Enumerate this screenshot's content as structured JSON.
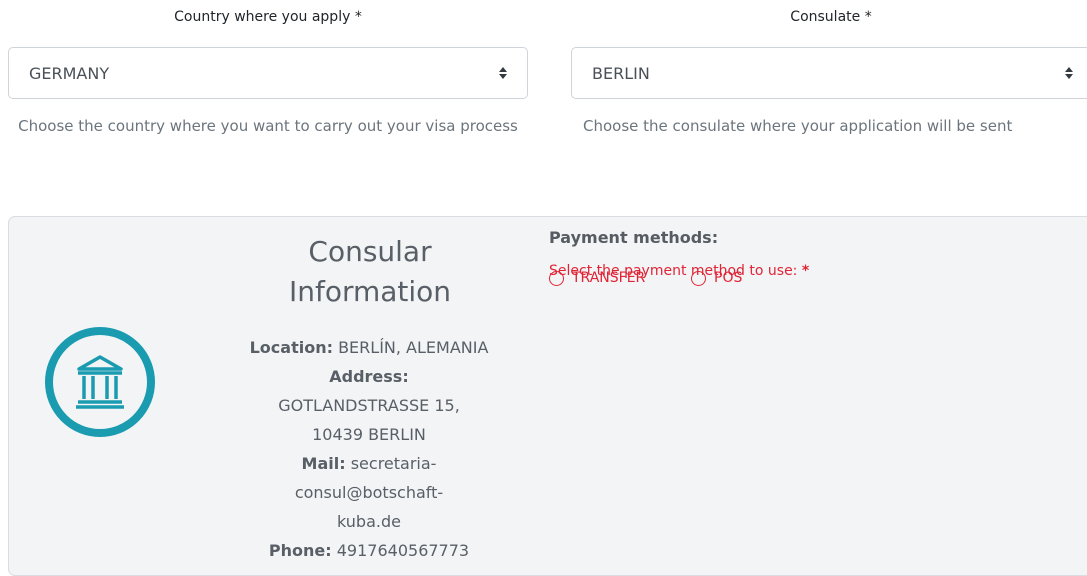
{
  "country": {
    "label": "Country where you apply *",
    "selected": "GERMANY",
    "help": "Choose the country where you want to carry out your visa process"
  },
  "consulate": {
    "label": "Consulate *",
    "selected": "BERLIN",
    "help": "Choose the consulate where your application will be sent"
  },
  "consular_info": {
    "title": "Consular Information",
    "location_label": "Location:",
    "location_value": "BERLÍN, ALEMANIA",
    "address_label": "Address:",
    "address_value": "GOTLANDSTRASSE 15, 10439 BERLIN",
    "mail_label": "Mail:",
    "mail_value": "secretaria-consul@botschaft-kuba.de",
    "phone_label": "Phone:",
    "phone_value": "4917640567773",
    "icon": "bank-icon",
    "accent_color": "#1a9bb0"
  },
  "payment": {
    "title": "Payment methods:",
    "prompt": "Select the payment method to use:",
    "required_mark": "*",
    "options": [
      "TRANSFER",
      "POS"
    ],
    "warning_color": "#e02435"
  }
}
